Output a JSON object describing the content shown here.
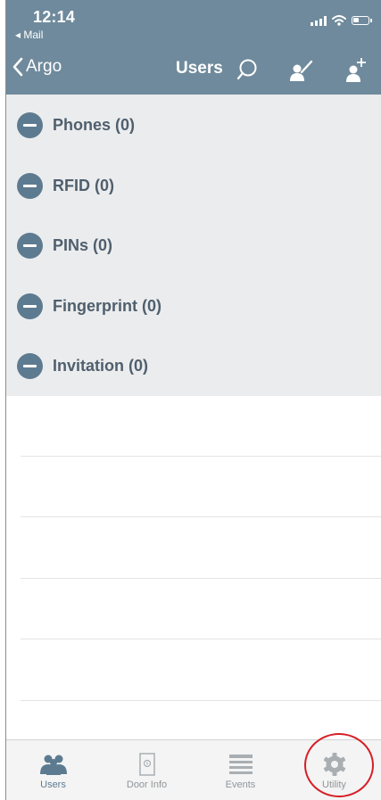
{
  "status_bar": {
    "time": "12:14",
    "back_app": "◂ Mail"
  },
  "nav_bar": {
    "back_label": "Argo",
    "title": "Users",
    "actions": [
      "search-icon",
      "edit-user-icon",
      "add-user-icon"
    ]
  },
  "credentials": [
    {
      "label": "Phones (0)"
    },
    {
      "label": "RFID (0)"
    },
    {
      "label": "PINs (0)"
    },
    {
      "label": "Fingerprint (0)"
    },
    {
      "label": "Invitation (0)"
    }
  ],
  "tab_bar": {
    "tabs": [
      {
        "label": "Users",
        "icon": "users-icon",
        "active": true
      },
      {
        "label": "Door Info",
        "icon": "door-icon",
        "active": false
      },
      {
        "label": "Events",
        "icon": "events-list-icon",
        "active": false
      },
      {
        "label": "Utility",
        "icon": "gear-icon",
        "active": false
      }
    ]
  },
  "colors": {
    "header_bg": "#6f8a9c",
    "accent": "#5d7b90",
    "list_bg": "#ebeced",
    "highlight_ring": "#d61f26"
  }
}
